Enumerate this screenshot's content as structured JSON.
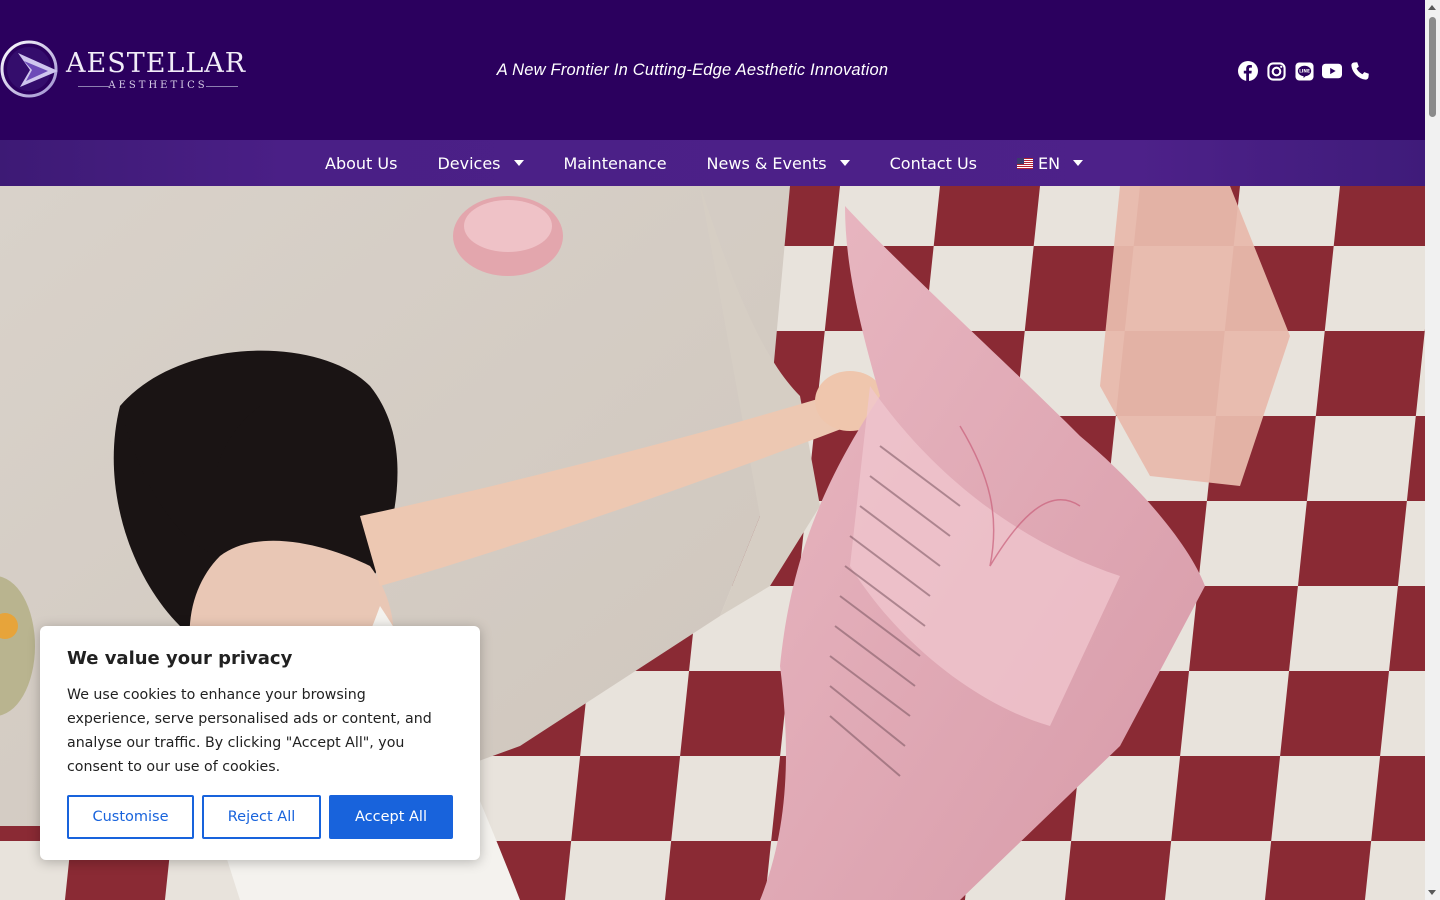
{
  "brand": {
    "name": "AESTELLAR",
    "sub": "AESTHETICS"
  },
  "header": {
    "tagline": "A New Frontier In Cutting-Edge Aesthetic Innovation",
    "social_icons": [
      "facebook-icon",
      "instagram-icon",
      "line-icon",
      "youtube-icon",
      "phone-icon"
    ]
  },
  "nav": {
    "items": [
      {
        "label": "About Us",
        "dropdown": false
      },
      {
        "label": "Devices",
        "dropdown": true
      },
      {
        "label": "Maintenance",
        "dropdown": false
      },
      {
        "label": "News & Events",
        "dropdown": true
      },
      {
        "label": "Contact Us",
        "dropdown": false
      }
    ],
    "language": {
      "label": "EN",
      "flag": "us-flag-icon",
      "dropdown": true
    }
  },
  "cookie_banner": {
    "title": "We value your privacy",
    "body": "We use cookies to enhance your browsing experience, serve personalised ads or content, and analyse our traffic. By clicking \"Accept All\", you consent to our use of cookies.",
    "buttons": {
      "customise": "Customise",
      "reject": "Reject All",
      "accept": "Accept All"
    }
  },
  "colors": {
    "header_bg": "#2b005e",
    "nav_bg": "#4a1f86",
    "button_blue": "#1863dc"
  }
}
